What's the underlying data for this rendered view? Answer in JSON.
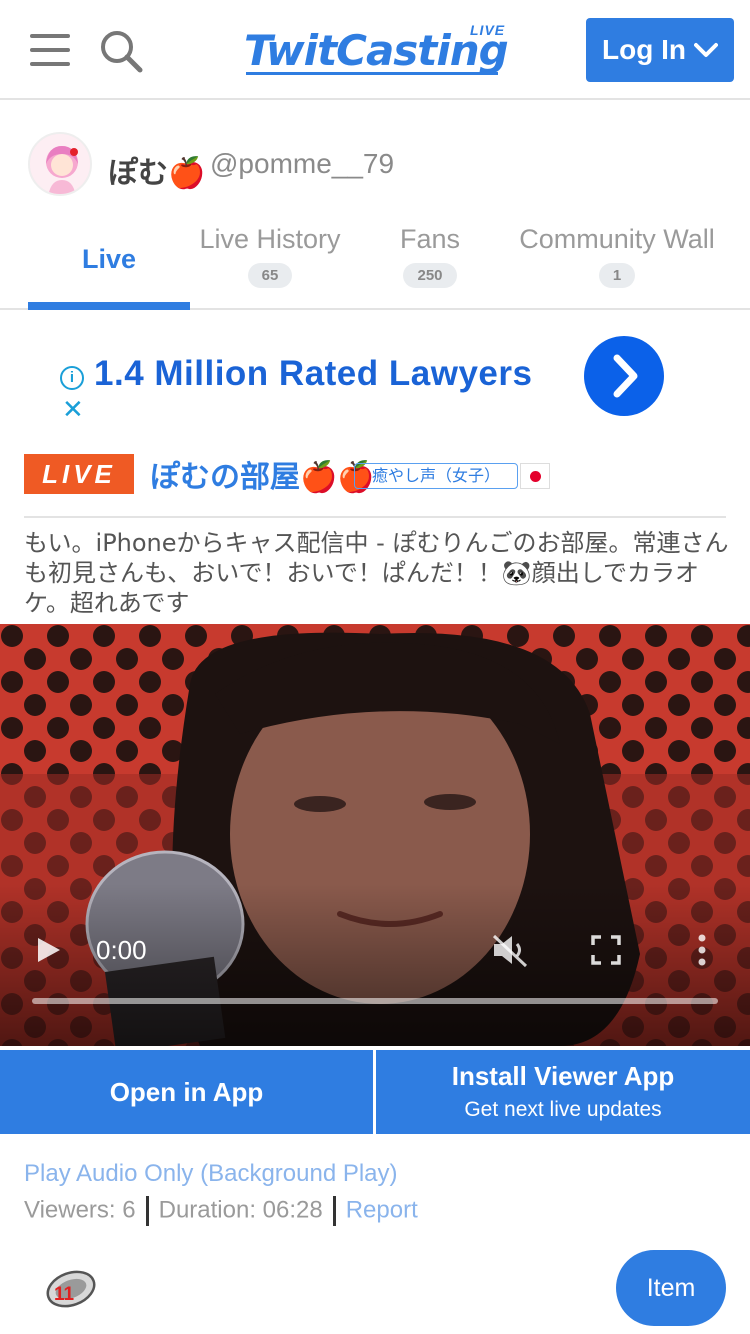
{
  "header": {
    "logo_text": "TwitCasting",
    "logo_live": "LIVE",
    "login_label": "Log In"
  },
  "profile": {
    "name": "ぽむ🍎",
    "handle": "@pomme__79"
  },
  "tabs": [
    {
      "label": "Live",
      "count": ""
    },
    {
      "label": "Live History",
      "count": "65"
    },
    {
      "label": "Fans",
      "count": "250"
    },
    {
      "label": "Community Wall",
      "count": "1"
    }
  ],
  "ad": {
    "title": "1.4 Million Rated Lawyers"
  },
  "live": {
    "badge": "LIVE",
    "title": "ぽむの部屋🍎🍎",
    "category": "癒やし声（女子）",
    "description": "もい。iPhoneからキャス配信中 - ぽむりんごのお部屋。常連さんも初見さんも、おいで！おいで！ぱんだ！！🐼顔出しでカラオケ。超れあです"
  },
  "player": {
    "time": "0:00"
  },
  "app_buttons": {
    "open_app": "Open in App",
    "install_title": "Install Viewer App",
    "install_sub": "Get next live updates"
  },
  "info": {
    "audio_only": "Play Audio Only (Background Play)",
    "viewers": "Viewers: 6",
    "duration": "Duration: 06:28",
    "report": "Report"
  },
  "bottom": {
    "coin_count": "11",
    "item_label": "Item"
  },
  "colors": {
    "accent": "#2f7de1",
    "live_badge": "#ef5a24",
    "ad_blue": "#1a63d6",
    "link_light": "#8ab4ec"
  }
}
